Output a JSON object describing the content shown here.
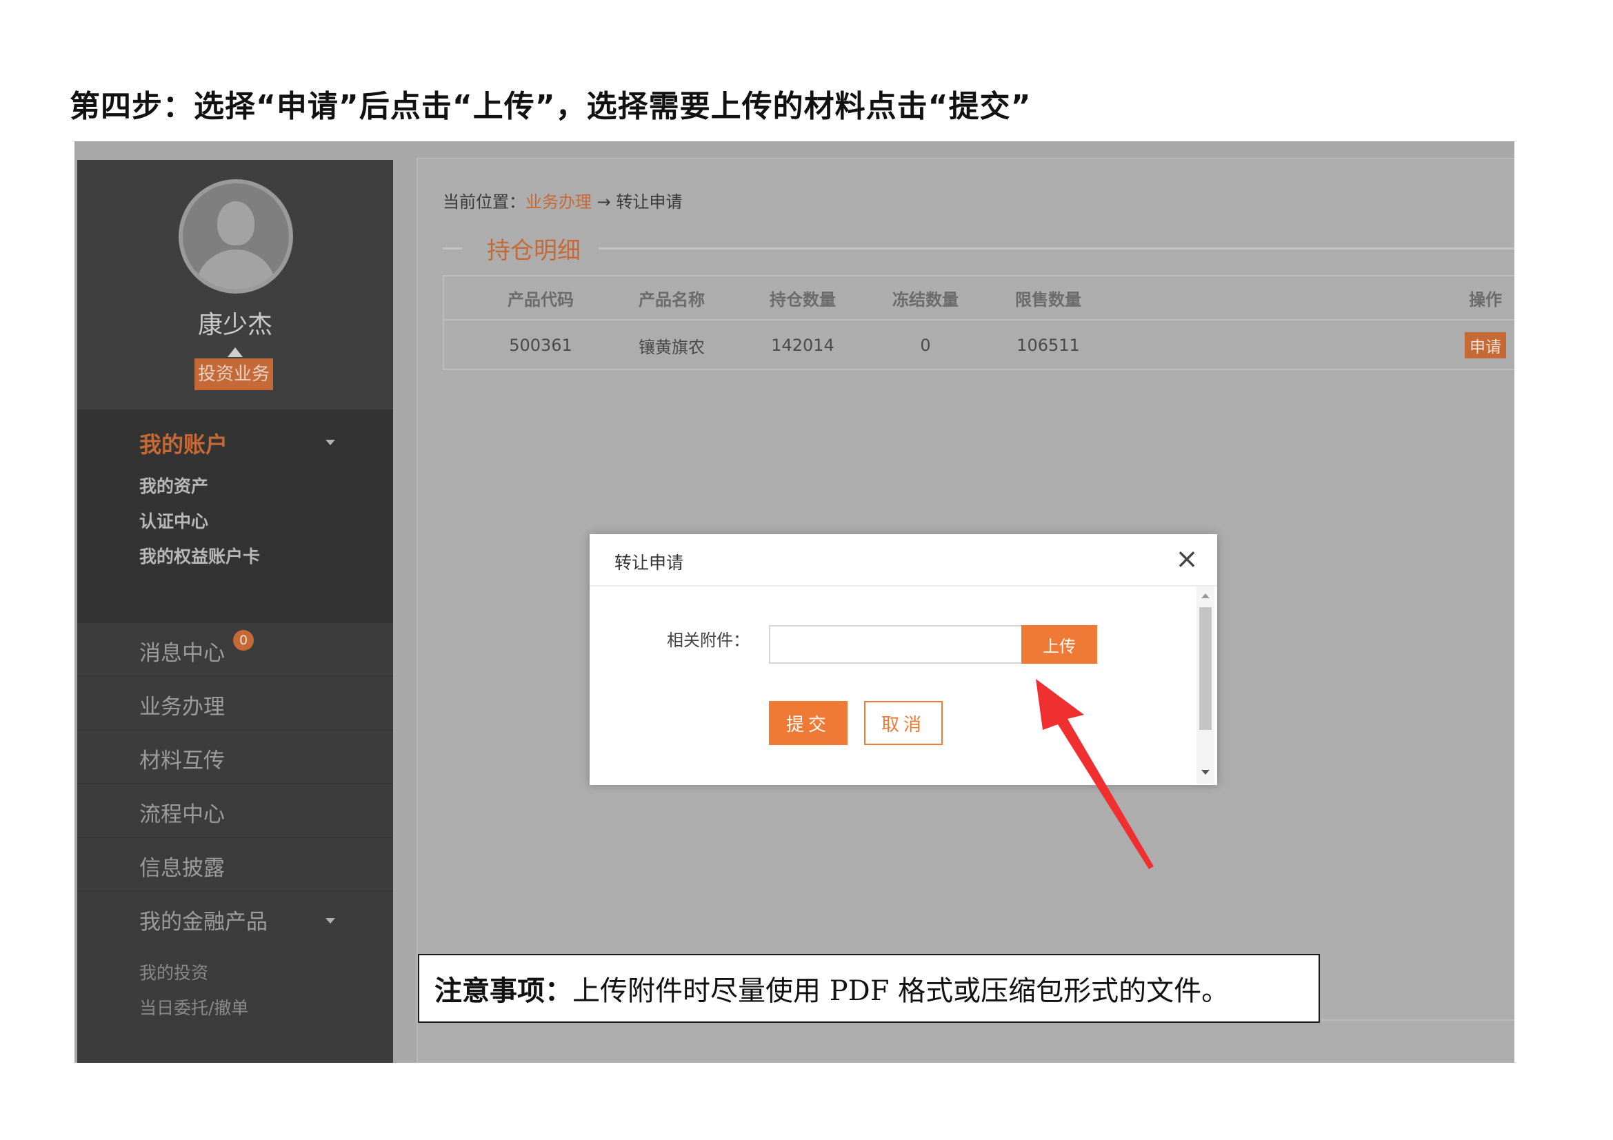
{
  "doc": {
    "heading": "第四步：选择“申请”后点击“上传”，选择需要上传的材料点击“提交”",
    "note_label": "注意事项：",
    "note_text": "上传附件时尽量使用 PDF 格式或压缩包形式的文件。"
  },
  "sidebar": {
    "user_name": "康少杰",
    "role_badge": "投资业务",
    "account_section": {
      "title": "我的账户",
      "items": [
        "我的资产",
        "认证中心",
        "我的权益账户卡"
      ]
    },
    "nav": [
      {
        "label": "消息中心",
        "badge": "0"
      },
      {
        "label": "业务办理"
      },
      {
        "label": "材料互传"
      },
      {
        "label": "流程中心"
      },
      {
        "label": "信息披露"
      },
      {
        "label": "我的金融产品"
      }
    ],
    "products_sub": [
      "我的投资",
      "当日委托/撤单"
    ]
  },
  "main": {
    "breadcrumb": {
      "prefix": "当前位置：",
      "link": "业务办理",
      "separator": " → ",
      "current": "转让申请"
    },
    "section_title": "持仓明细",
    "table": {
      "headers": [
        "产品代码",
        "产品名称",
        "持仓数量",
        "冻结数量",
        "限售数量",
        "操作"
      ],
      "rows": [
        {
          "code": "500361",
          "name": "镶黄旗农",
          "holding": "142014",
          "frozen": "0",
          "restricted": "106511",
          "action": "申请"
        }
      ]
    }
  },
  "modal": {
    "title": "转让申请",
    "close_glyph": "×",
    "field_label": "相关附件：",
    "file_value": "",
    "upload_label": "上传",
    "submit_label": "提交",
    "cancel_label": "取消"
  },
  "colors": {
    "accent": "#ef7a35",
    "accent_dim": "#c56a36",
    "sidebar_bg": "#3c3c3c",
    "overlay_bg": "#adadad",
    "arrow": "#f03030"
  },
  "icons": {
    "avatar": "user-silhouette-icon",
    "close": "close-icon",
    "dropdown": "chevron-down-icon",
    "pointer": "red-arrow-icon"
  }
}
